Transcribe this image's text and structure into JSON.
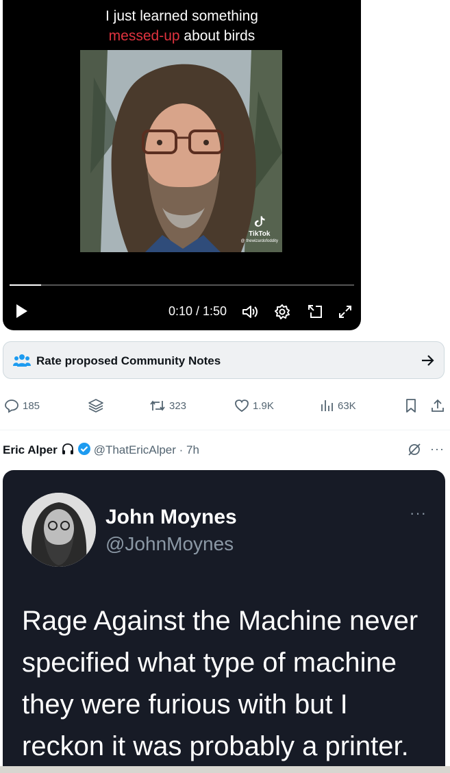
{
  "video": {
    "caption_line1": "I just learned something",
    "caption_highlight": "messed-up",
    "caption_rest": " about birds",
    "watermark_brand": "TikTok",
    "watermark_handle": "@ thewizardofoddity",
    "time_display": "0:10 / 1:50",
    "progress_fraction": 0.091,
    "colors": {
      "highlight": "#e0333f"
    }
  },
  "community_notes": {
    "label": "Rate proposed Community Notes",
    "icon": "people-icon",
    "arrow_icon": "arrow-right-icon"
  },
  "actions": {
    "replies": "185",
    "retweets": "323",
    "likes": "1.9K",
    "views": "63K"
  },
  "tweet": {
    "author_name": "Eric Alper",
    "handle_time": "@ThatEricAlper · 7h",
    "embedded": {
      "name": "John Moynes",
      "handle": "@JohnMoynes",
      "more": "···",
      "text": "Rage Against the Machine never specified what type of machine they were furious with but I reckon it was probably a printer."
    }
  }
}
